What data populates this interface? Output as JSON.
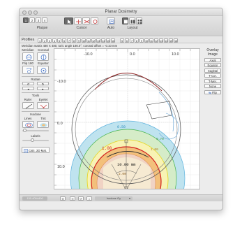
{
  "window": {
    "title": "Planar Dosimetry"
  },
  "toolbar": {
    "plaque_buttons": [
      "1",
      "2",
      "3",
      "4"
    ],
    "plaque_selected": 0,
    "plaque_label": "Plaque",
    "cursor_label": "Cursor",
    "auto_label": "Auto",
    "layout_label": "Layout",
    "layout_buttons": [
      "5",
      "6",
      "7",
      "8",
      "9",
      "10",
      "11",
      "12",
      "13",
      "14",
      "15",
      "16"
    ]
  },
  "profiles": {
    "label": "Profiles",
    "buttons": [
      "1",
      "2",
      "3",
      "4",
      "5",
      "6",
      "7",
      "8",
      "9",
      "10",
      "11",
      "12",
      "13",
      "14",
      "15",
      "16"
    ]
  },
  "info_line": "Meridian matrix 480 X 480, toric angle 180.0°, coronal offset = -0.10 mm",
  "left_panel": {
    "meridian": "Meridian",
    "coronal": "Coronal",
    "flip180": "Flip 180",
    "equator": "Equator",
    "rotate": "Rotate",
    "tools": "Tools",
    "ruler": "Ruler",
    "eyelet": "Eyelet",
    "isodose": "Isodose",
    "lines": "Lines",
    "tint": "Tint",
    "labels": "Labels",
    "calc": "Calc. 2D Mat."
  },
  "right_panel": {
    "title": "Overlay Image",
    "buttons": [
      "Axial",
      "Equator",
      "Sagittal",
      "T-Cor.",
      "T-Mer.",
      "None",
      "Flip"
    ]
  },
  "plot": {
    "axis_ticks_top": [
      "-10.0",
      "0.0",
      "10.0"
    ],
    "axis_ticks_left": [
      "-10.0",
      "0.0",
      "10.0"
    ],
    "isodose_labels": [
      "0.50",
      "0.70",
      "1.00",
      "1.00",
      "10.00 mm",
      "2.00"
    ],
    "colors": {
      "level_050": "#bfe3ef",
      "level_070": "#d5ecc8",
      "level_100": "#f3c07b",
      "level_200": "#f0d3c4",
      "red_line": "#d21f1f",
      "yellow_line": "#e5d41b",
      "green_line": "#44b24a",
      "cyan_line": "#5fb3de"
    }
  },
  "statusbar": {
    "left_text": "130.4004400",
    "select_text": "Isodose Gy"
  }
}
